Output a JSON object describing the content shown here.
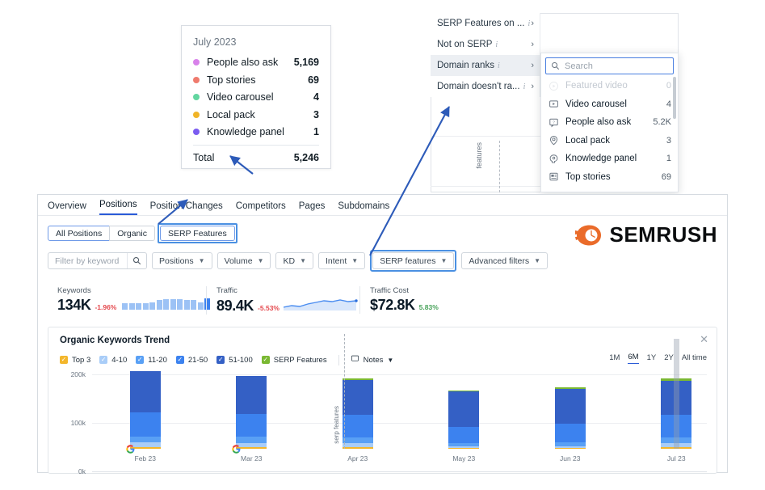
{
  "tooltip": {
    "title": "July 2023",
    "rows": [
      {
        "label": "People also ask",
        "value": "5,169",
        "color": "#d882ea"
      },
      {
        "label": "Top stories",
        "value": "69",
        "color": "#ef7b6e"
      },
      {
        "label": "Video carousel",
        "value": "4",
        "color": "#63d6a0"
      },
      {
        "label": "Local pack",
        "value": "3",
        "color": "#f0b428"
      },
      {
        "label": "Knowledge panel",
        "value": "1",
        "color": "#7b5cf0"
      }
    ],
    "total_label": "Total",
    "total_value": "5,246"
  },
  "dropdown": {
    "items": [
      {
        "label": "SERP Features on ...",
        "info": "i",
        "chevron": "›",
        "selected": false
      },
      {
        "label": "Not on SERP",
        "info": "i",
        "chevron": "›",
        "selected": false
      },
      {
        "label": "Domain ranks",
        "info": "i",
        "chevron": "›",
        "selected": true
      },
      {
        "label": "Domain doesn't ra...",
        "info": "i",
        "chevron": "›",
        "selected": false
      }
    ],
    "chart_peek_label": "features",
    "search": {
      "placeholder": "Search",
      "icon": "search-icon"
    },
    "submenu": [
      {
        "label": "Featured video",
        "count": "0",
        "icon": "featured-video-icon",
        "disabled": true
      },
      {
        "label": "Video carousel",
        "count": "4",
        "icon": "video-carousel-icon",
        "disabled": false
      },
      {
        "label": "People also ask",
        "count": "5.2K",
        "icon": "people-also-ask-icon",
        "disabled": false
      },
      {
        "label": "Local pack",
        "count": "3",
        "icon": "local-pack-icon",
        "disabled": false
      },
      {
        "label": "Knowledge panel",
        "count": "1",
        "icon": "knowledge-panel-icon",
        "disabled": false
      },
      {
        "label": "Top stories",
        "count": "69",
        "icon": "top-stories-icon",
        "disabled": false
      }
    ]
  },
  "app": {
    "tabs": [
      {
        "label": "Overview",
        "active": false
      },
      {
        "label": "Positions",
        "active": true
      },
      {
        "label": "Position Changes",
        "active": false
      },
      {
        "label": "Competitors",
        "active": false
      },
      {
        "label": "Pages",
        "active": false
      },
      {
        "label": "Subdomains",
        "active": false
      }
    ],
    "segments": [
      {
        "label": "All Positions",
        "active": true,
        "highlighted": false
      },
      {
        "label": "Organic",
        "active": false,
        "highlighted": false
      },
      {
        "label": "SERP Features",
        "active": false,
        "highlighted": true
      }
    ],
    "filter_placeholder": "Filter by keyword",
    "filters": [
      {
        "label": "Positions",
        "highlighted": false
      },
      {
        "label": "Volume",
        "highlighted": false
      },
      {
        "label": "KD",
        "highlighted": false
      },
      {
        "label": "Intent",
        "highlighted": false
      },
      {
        "label": "SERP features",
        "highlighted": true
      },
      {
        "label": "Advanced filters",
        "highlighted": false
      }
    ],
    "brand": "SEMRUSH",
    "metrics": [
      {
        "label": "Keywords",
        "value": "134K",
        "delta": "-1.96%",
        "trend": "neg"
      },
      {
        "label": "Traffic",
        "value": "89.4K",
        "delta": "-5.53%",
        "trend": "neg"
      },
      {
        "label": "Traffic Cost",
        "value": "$72.8K",
        "delta": "5.83%",
        "trend": "pos"
      }
    ]
  },
  "chart_card": {
    "title": "Organic Keywords Trend",
    "close_icon": "close-icon",
    "legend": [
      {
        "label": "Top 3",
        "color": "#f3b62b",
        "checked": true
      },
      {
        "label": "4-10",
        "color": "#a9cdf8",
        "checked": true
      },
      {
        "label": "11-20",
        "color": "#59a0f5",
        "checked": true
      },
      {
        "label": "21-50",
        "color": "#3c82ef",
        "checked": true
      },
      {
        "label": "51-100",
        "color": "#3460c5",
        "checked": true
      },
      {
        "label": "SERP Features",
        "color": "#7ab832",
        "checked": true
      }
    ],
    "notes_label": "Notes",
    "ranges": [
      {
        "label": "1M",
        "active": false
      },
      {
        "label": "6M",
        "active": true
      },
      {
        "label": "1Y",
        "active": false
      },
      {
        "label": "2Y",
        "active": false
      },
      {
        "label": "All time",
        "active": false
      }
    ],
    "annotation_label": "serp features"
  },
  "chart_data": {
    "type": "bar",
    "stacked": true,
    "title": "Organic Keywords Trend",
    "xlabel": "",
    "ylabel": "",
    "ylim": [
      0,
      200000
    ],
    "yticks": [
      0,
      100000,
      200000
    ],
    "ytick_labels": [
      "0k",
      "100k",
      "200k"
    ],
    "grid": true,
    "legend_position": "top-left",
    "categories": [
      "Feb 23",
      "Mar 23",
      "Apr 23",
      "May 23",
      "Jun 23",
      "Jul 23"
    ],
    "series": [
      {
        "name": "Top 3",
        "color": "#f3b62b",
        "values": [
          3200,
          3000,
          3000,
          1200,
          1200,
          2600
        ]
      },
      {
        "name": "4-10",
        "color": "#a9cdf8",
        "values": [
          9500,
          9000,
          8500,
          3000,
          3500,
          9000
        ]
      },
      {
        "name": "11-20",
        "color": "#59a0f5",
        "values": [
          13000,
          12500,
          12000,
          7500,
          9000,
          12500
        ]
      },
      {
        "name": "21-50",
        "color": "#3c82ef",
        "values": [
          50000,
          48000,
          46000,
          34000,
          38000,
          46000
        ]
      },
      {
        "name": "51-100",
        "color": "#3460c5",
        "values": [
          84000,
          78000,
          73000,
          72000,
          72000,
          70000
        ]
      },
      {
        "name": "SERP Features",
        "color": "#7ab832",
        "values": [
          0,
          0,
          2500,
          2500,
          2500,
          5246
        ]
      }
    ],
    "totals": [
      159700,
      150500,
      145000,
      120200,
      126200,
      145346
    ],
    "markers": [
      {
        "category": "Feb 23",
        "type": "google-update-icon"
      },
      {
        "category": "Mar 23",
        "type": "google-update-icon"
      }
    ],
    "hover_category": "Jul 23",
    "annotation": {
      "category": "Apr 23",
      "label": "serp features"
    }
  }
}
